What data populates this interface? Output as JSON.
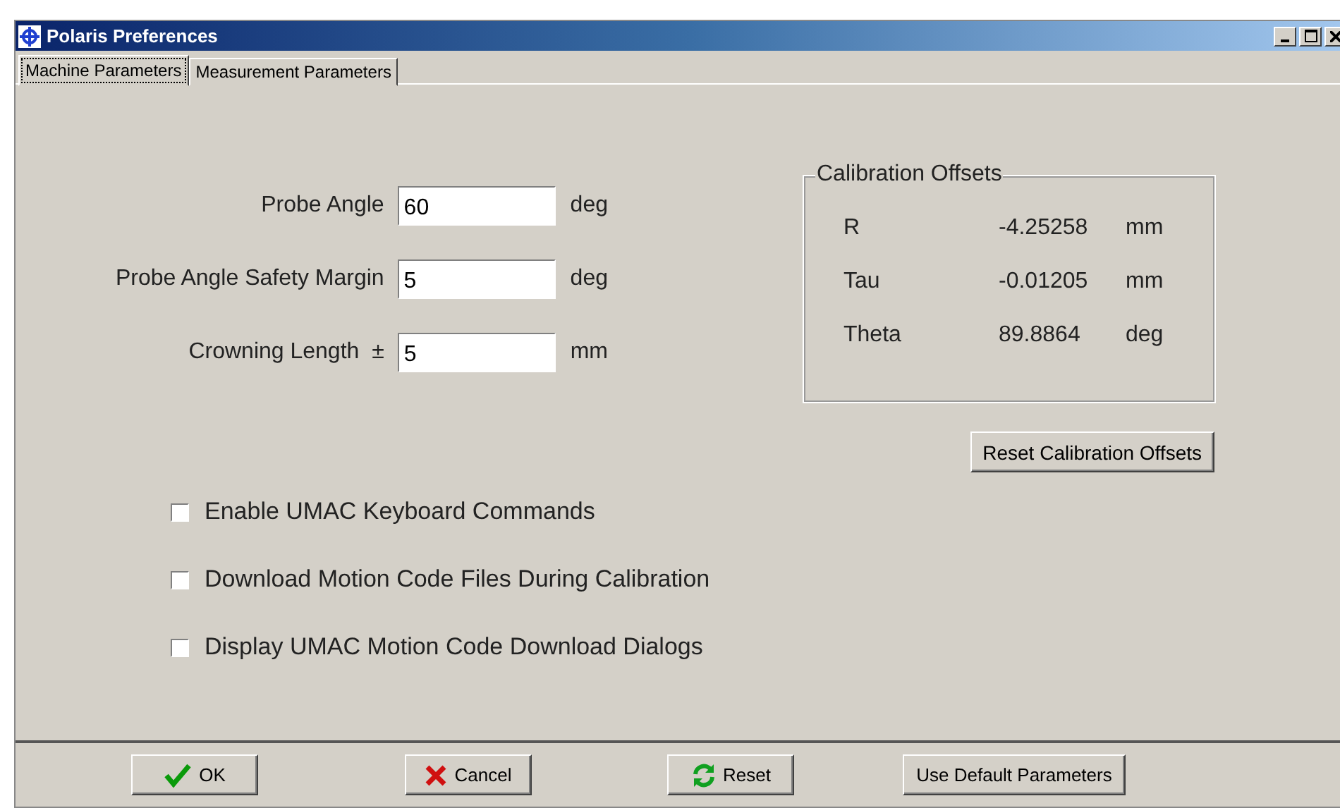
{
  "window": {
    "title": "Polaris Preferences"
  },
  "tabs": [
    {
      "label": "Machine Parameters",
      "selected": true
    },
    {
      "label": "Measurement Parameters",
      "selected": false
    }
  ],
  "fields": [
    {
      "label": "Probe Angle",
      "value": "60",
      "unit": "deg"
    },
    {
      "label": "Probe Angle Safety Margin",
      "value": "5",
      "unit": "deg"
    },
    {
      "label": "Crowning Length  ±",
      "value": "5",
      "unit": "mm"
    }
  ],
  "calibration": {
    "title": "Calibration Offsets",
    "rows": [
      {
        "name": "R",
        "value": "-4.25258",
        "unit": "mm"
      },
      {
        "name": "Tau",
        "value": "-0.01205",
        "unit": "mm"
      },
      {
        "name": "Theta",
        "value": "89.8864",
        "unit": "deg"
      }
    ],
    "button": "Reset Calibration Offsets"
  },
  "checkboxes": [
    {
      "label": "Enable UMAC Keyboard Commands",
      "checked": false
    },
    {
      "label": "Download Motion Code Files During Calibration",
      "checked": false
    },
    {
      "label": "Display UMAC Motion Code Download Dialogs",
      "checked": false
    }
  ],
  "buttons": [
    {
      "kind": "ok",
      "label": "OK"
    },
    {
      "kind": "cancel",
      "label": "Cancel"
    },
    {
      "kind": "reset",
      "label": "Reset"
    },
    {
      "kind": "plain",
      "label": "Use Default Parameters"
    }
  ]
}
